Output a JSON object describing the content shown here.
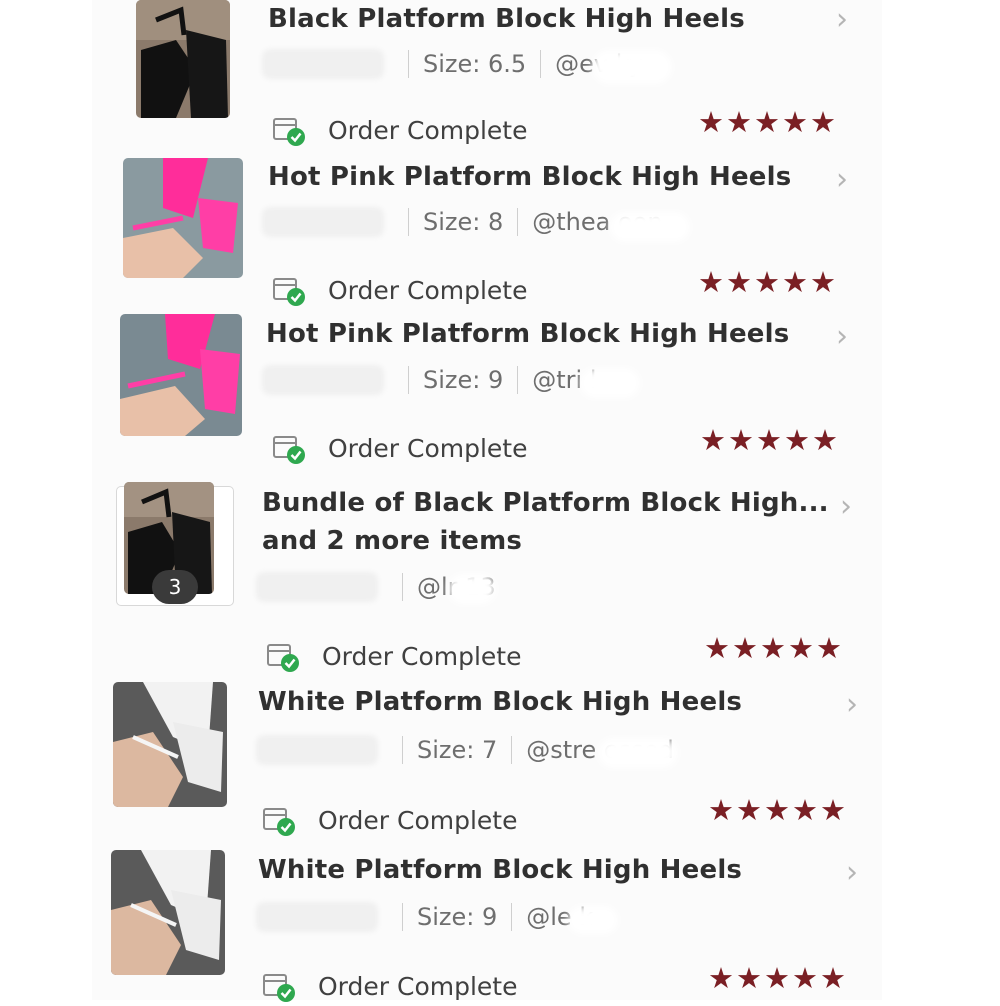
{
  "orders": [
    {
      "title": "Black Platform Block High Heels",
      "size": "Size: 6.5",
      "handle": "@ev      ky",
      "status": "Order Complete",
      "rating": "★★★★★",
      "thumb_color": "black"
    },
    {
      "title": "Hot Pink Platform Block High Heels",
      "size": "Size: 8",
      "handle": "@thea        oon",
      "status": "Order Complete",
      "rating": "★★★★★",
      "thumb_color": "pink"
    },
    {
      "title": "Hot Pink Platform Block High Heels",
      "size": "Size: 9",
      "handle": "@tri       l",
      "status": "Order Complete",
      "rating": "★★★★★",
      "thumb_color": "pink"
    },
    {
      "title": "Bundle of Black Platform Block High...",
      "subtitle": "and 2 more items",
      "handle": "@lr      13",
      "badge": "3",
      "status": "Order Complete",
      "rating": "★★★★★",
      "thumb_color": "black"
    },
    {
      "title": "White Platform Block High Heels",
      "size": "Size: 7",
      "handle": "@stre        essed",
      "status": "Order Complete",
      "rating": "★★★★★",
      "thumb_color": "white"
    },
    {
      "title": "White Platform Block High Heels",
      "size": "Size: 9",
      "handle": "@le      k",
      "status": "Order Complete",
      "rating": "★★★★★",
      "thumb_color": "white"
    }
  ],
  "icons": {
    "chevron": "chevron-right-icon",
    "status": "order-complete-icon"
  },
  "colors": {
    "stars": "#7a1f24",
    "check": "#2fa84f",
    "badge": "#3a3a3a"
  },
  "last_status": "Order Complete",
  "last_rating": "★★★★★"
}
